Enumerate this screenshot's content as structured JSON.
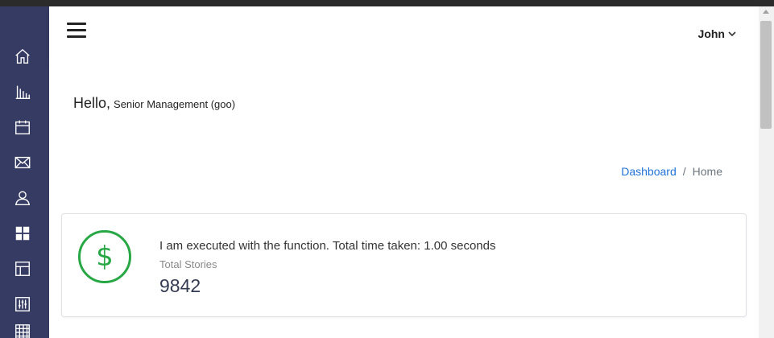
{
  "sidebar": {
    "items": [
      {
        "icon": "home-icon"
      },
      {
        "icon": "bar-chart-icon"
      },
      {
        "icon": "calendar-icon"
      },
      {
        "icon": "mail-icon"
      },
      {
        "icon": "user-icon"
      },
      {
        "icon": "grid-icon"
      },
      {
        "icon": "layout-icon"
      },
      {
        "icon": "sliders-icon"
      },
      {
        "icon": "table-icon"
      }
    ]
  },
  "header": {
    "user_name": "John"
  },
  "greeting": {
    "hello": "Hello,",
    "role": "Senior Management (goo)"
  },
  "breadcrumb": {
    "link": "Dashboard",
    "separator": "/",
    "current": "Home"
  },
  "card": {
    "icon": "dollar-icon",
    "icon_glyph": "$",
    "message": "I am executed with the function. Total time taken: 1.00 seconds",
    "label": "Total Stories",
    "value": "9842"
  },
  "colors": {
    "sidebar_bg": "#353b63",
    "accent_green": "#28a745",
    "link_blue": "#1f73d8"
  }
}
